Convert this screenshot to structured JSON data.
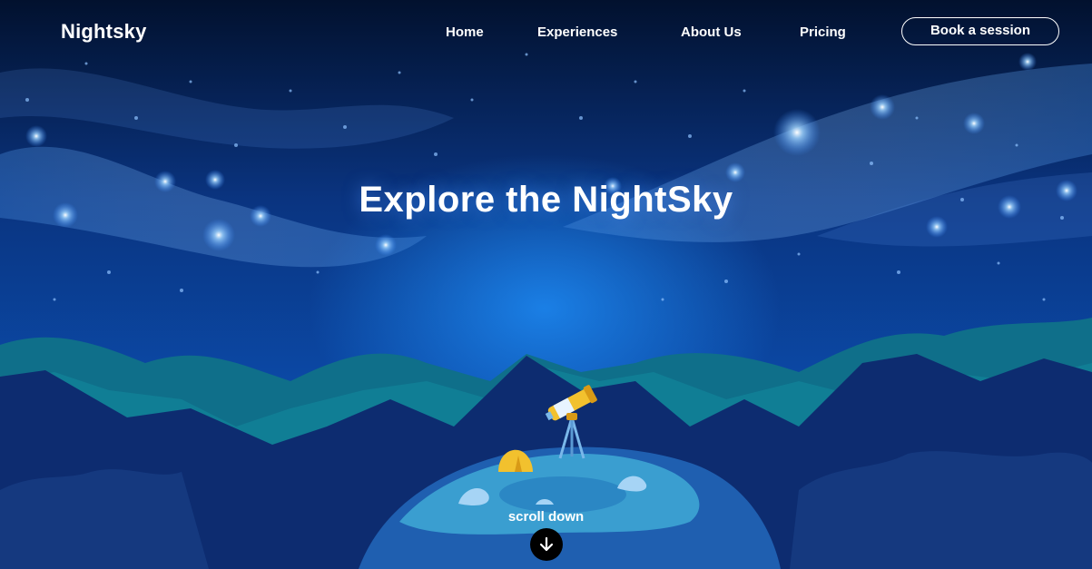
{
  "brand": {
    "logo": "Nightsky"
  },
  "nav": {
    "items": [
      {
        "label": "Home"
      },
      {
        "label": "Experiences"
      },
      {
        "label": "About Us"
      },
      {
        "label": "Pricing"
      }
    ],
    "cta_label": "Book a session"
  },
  "hero": {
    "title": "Explore the NightSky",
    "scroll_label": "scroll down"
  },
  "icons": {
    "scroll": "arrow-down-icon",
    "telescope": "telescope-icon",
    "tent": "tent-icon"
  },
  "colors": {
    "sky_top": "#04163f",
    "sky_mid": "#0b4aa8",
    "glow": "#1a78e0",
    "teal_mountains": "#0f6f8a",
    "dark_mountains": "#0d2c70",
    "hill": "#1f5fb0",
    "grass": "#3a9ed0",
    "telescope": "#f2c12e",
    "text": "#ffffff",
    "button_bg": "#000000"
  }
}
